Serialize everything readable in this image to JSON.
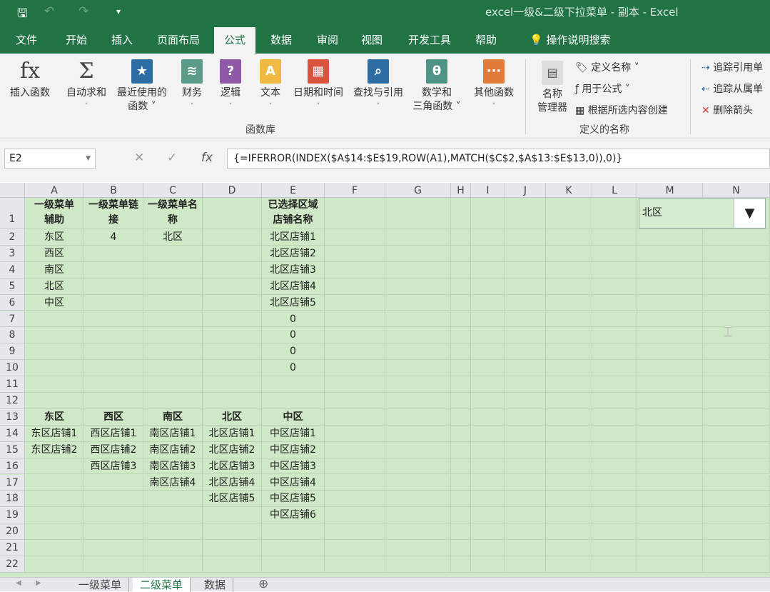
{
  "window": {
    "title": "excel一级&二级下拉菜单 - 副本  -  Excel"
  },
  "quick_access": {
    "save": "🖫",
    "undo": "↶",
    "redo": "↷",
    "customize": "▾"
  },
  "tabs": [
    "文件",
    "开始",
    "插入",
    "页面布局",
    "公式",
    "数据",
    "审阅",
    "视图",
    "开发工具",
    "帮助"
  ],
  "active_tab": "公式",
  "tell_me": "操作说明搜索",
  "ribbon": {
    "function_library": {
      "label": "函数库",
      "buttons": [
        {
          "line1": "插入函数",
          "line2": "",
          "icon": "fx-icon",
          "color": "#f3f3f3",
          "glyph": "fx"
        },
        {
          "line1": "自动求和",
          "line2": "˅",
          "icon": "sigma-icon",
          "color": "#f3f3f3",
          "glyph": "Σ"
        },
        {
          "line1": "最近使用的",
          "line2": "函数 ˅",
          "icon": "star-book-icon",
          "color": "#2e6da4",
          "glyph": "★"
        },
        {
          "line1": "财务",
          "line2": "˅",
          "icon": "coins-book-icon",
          "color": "#5b9b8a",
          "glyph": "≋"
        },
        {
          "line1": "逻辑",
          "line2": "˅",
          "icon": "question-book-icon",
          "color": "#8e5aa8",
          "glyph": "?"
        },
        {
          "line1": "文本",
          "line2": "˅",
          "icon": "text-book-icon",
          "color": "#f0b942",
          "glyph": "A"
        },
        {
          "line1": "日期和时间",
          "line2": "˅",
          "icon": "calendar-book-icon",
          "color": "#d9543f",
          "glyph": "▦"
        },
        {
          "line1": "查找与引用",
          "line2": "˅",
          "icon": "search-book-icon",
          "color": "#2e6da4",
          "glyph": "⌕"
        },
        {
          "line1": "数学和",
          "line2": "三角函数 ˅",
          "icon": "theta-book-icon",
          "color": "#4f9487",
          "glyph": "θ"
        },
        {
          "line1": "其他函数",
          "line2": "˅",
          "icon": "more-book-icon",
          "color": "#e07b39",
          "glyph": "···"
        }
      ]
    },
    "defined_names": {
      "label": "定义的名称",
      "manager_line1": "名称",
      "manager_line2": "管理器",
      "define": "定义名称 ˅",
      "use_in_formula": "用于公式 ˅",
      "create_from_selection": "根据所选内容创建"
    },
    "auditing": {
      "trace_precedents": "追踪引用单",
      "trace_dependents": "追踪从属单",
      "remove_arrows": "删除箭头"
    }
  },
  "formula_bar": {
    "name_box": "E2",
    "formula": "{=IFERROR(INDEX($A$14:$E$19,ROW(A1),MATCH($C$2,$A$13:$E$13,0)),0)}",
    "cancel": "✕",
    "enter": "✓",
    "fx": "fx"
  },
  "columns": [
    "A",
    "B",
    "C",
    "D",
    "E",
    "F",
    "G",
    "H",
    "I",
    "J",
    "K",
    "L",
    "M",
    "N"
  ],
  "rows": [
    {
      "n": "1",
      "cells": [
        "一级菜单\n辅助",
        "一级菜单链\n接",
        "一级菜单名\n称",
        "",
        "已选择区域\n店铺名称"
      ],
      "bold": true
    },
    {
      "n": "2",
      "cells": [
        "东区",
        "4",
        "北区",
        "",
        "北区店铺1"
      ]
    },
    {
      "n": "3",
      "cells": [
        "西区",
        "",
        "",
        "",
        "北区店铺2"
      ]
    },
    {
      "n": "4",
      "cells": [
        "南区",
        "",
        "",
        "",
        "北区店铺3"
      ]
    },
    {
      "n": "5",
      "cells": [
        "北区",
        "",
        "",
        "",
        "北区店铺4"
      ]
    },
    {
      "n": "6",
      "cells": [
        "中区",
        "",
        "",
        "",
        "北区店铺5"
      ]
    },
    {
      "n": "7",
      "cells": [
        "",
        "",
        "",
        "",
        "0"
      ]
    },
    {
      "n": "8",
      "cells": [
        "",
        "",
        "",
        "",
        "0"
      ]
    },
    {
      "n": "9",
      "cells": [
        "",
        "",
        "",
        "",
        "0"
      ]
    },
    {
      "n": "10",
      "cells": [
        "",
        "",
        "",
        "",
        "0"
      ]
    },
    {
      "n": "11",
      "cells": []
    },
    {
      "n": "12",
      "cells": []
    },
    {
      "n": "13",
      "cells": [
        "东区",
        "西区",
        "南区",
        "北区",
        "中区"
      ],
      "bold": true
    },
    {
      "n": "14",
      "cells": [
        "东区店铺1",
        "西区店铺1",
        "南区店铺1",
        "北区店铺1",
        "中区店铺1"
      ]
    },
    {
      "n": "15",
      "cells": [
        "东区店铺2",
        "西区店铺2",
        "南区店铺2",
        "北区店铺2",
        "中区店铺2"
      ]
    },
    {
      "n": "16",
      "cells": [
        "",
        "西区店铺3",
        "南区店铺3",
        "北区店铺3",
        "中区店铺3"
      ]
    },
    {
      "n": "17",
      "cells": [
        "",
        "",
        "南区店铺4",
        "北区店铺4",
        "中区店铺4"
      ]
    },
    {
      "n": "18",
      "cells": [
        "",
        "",
        "",
        "北区店铺5",
        "中区店铺5"
      ]
    },
    {
      "n": "19",
      "cells": [
        "",
        "",
        "",
        "",
        "中区店铺6"
      ]
    },
    {
      "n": "20",
      "cells": []
    },
    {
      "n": "21",
      "cells": []
    },
    {
      "n": "22",
      "cells": []
    }
  ],
  "combo": {
    "value": "北区",
    "arrow": "▼"
  },
  "sheets": [
    "一级菜单",
    "二级菜单",
    "数据"
  ],
  "active_sheet": "二级菜单",
  "add_sheet": "⊕",
  "colors": {
    "accent": "#217346",
    "grid_bg": "#cfe8c6"
  }
}
